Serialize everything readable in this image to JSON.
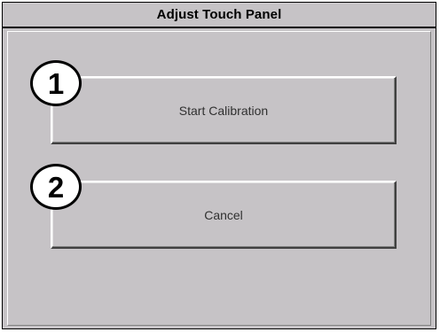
{
  "window": {
    "title": "Adjust Touch Panel"
  },
  "buttons": {
    "start_calibration": "Start Calibration",
    "cancel": "Cancel"
  },
  "callouts": {
    "first": "1",
    "second": "2"
  },
  "colors": {
    "panel_background": "#c6c3c6",
    "border": "#000000",
    "callout_fill": "#ffffff"
  }
}
